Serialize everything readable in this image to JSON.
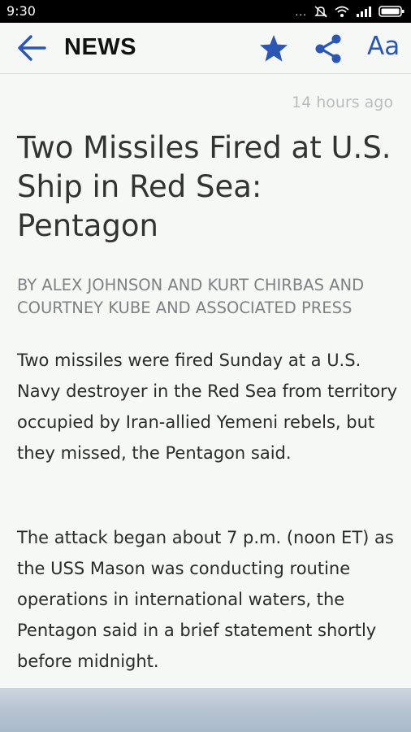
{
  "status_bar": {
    "time": "9:30",
    "dots": "...",
    "icons": [
      "silent-icon",
      "wifi-icon",
      "signal-icon",
      "battery-icon"
    ]
  },
  "app_bar": {
    "title": "NEWS",
    "font_button_label": "Aa",
    "icons": [
      "back-arrow-icon",
      "star-icon",
      "share-icon"
    ],
    "accent_color": "#2a56b6"
  },
  "article": {
    "timestamp": "14 hours ago",
    "headline": "Two Missiles Fired at U.S. Ship in Red Sea: Pentagon",
    "byline": "BY ALEX JOHNSON AND KURT CHIRBAS AND COURTNEY KUBE AND ASSOCIATED PRESS",
    "paragraphs": [
      "Two missiles were fired Sunday at a U.S. Navy destroyer in the Red Sea from territory occupied by Iran-allied Yemeni rebels, but they missed, the Pentagon said.",
      "The attack began about 7 p.m. (noon ET) as the USS Mason was conducting routine operations in international waters, the Pentagon said in a brief statement shortly before midnight."
    ]
  }
}
